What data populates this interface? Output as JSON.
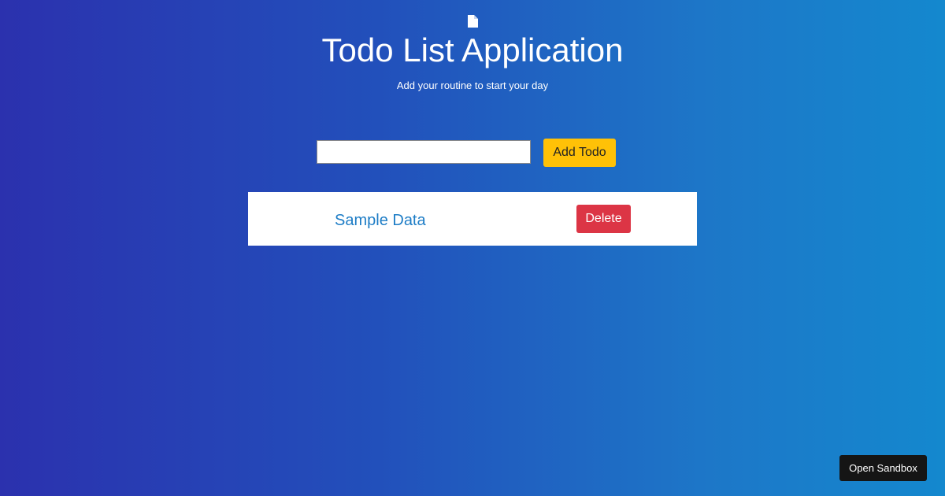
{
  "header": {
    "icon": "document-icon",
    "title": "Todo List Application",
    "subtitle": "Add your routine to start your day"
  },
  "form": {
    "input_value": "",
    "input_placeholder": "",
    "add_label": "Add Todo"
  },
  "todos": [
    {
      "text": "Sample Data",
      "delete_label": "Delete"
    }
  ],
  "sandbox": {
    "label": "Open Sandbox"
  },
  "colors": {
    "add_button": "#ffc107",
    "delete_button": "#dc3545",
    "todo_text": "#1e7dc6",
    "sandbox_button": "#151515"
  }
}
